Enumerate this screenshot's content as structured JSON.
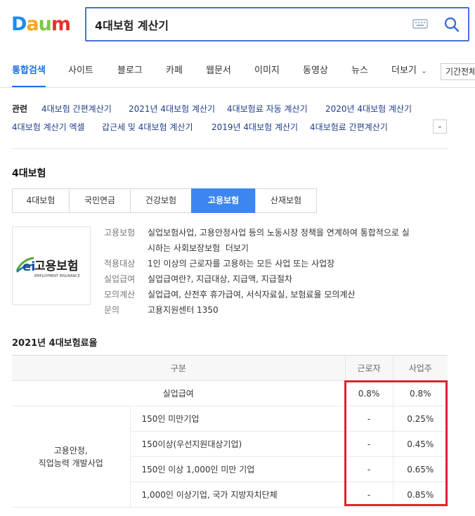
{
  "brand": {
    "logo_letters": [
      "D",
      "a",
      "u",
      "m"
    ],
    "colors": [
      "#1d8bf1",
      "#f5a623",
      "#7ac943",
      "#e5322d"
    ]
  },
  "search": {
    "query": "4대보험 계산기"
  },
  "nav": {
    "tabs": [
      "통합검색",
      "사이트",
      "블로그",
      "카페",
      "웹문서",
      "이미지",
      "동영상",
      "뉴스",
      "더보기"
    ],
    "active": "통합검색",
    "period": "기간전체"
  },
  "related": {
    "label": "관련",
    "links": [
      "4대보험 간편계산기",
      "2021년 4대보험 계산기",
      "4대보험료 자동 계산기",
      "2020년 4대보험 계산기",
      "4대보험 계산기 엑셀",
      "갑근세 및 4대보험 계산기",
      "2019년 4대보험 계산기",
      "4대보험료 간편계산기"
    ]
  },
  "section_title": "4대보험",
  "subtabs": [
    "4대보험",
    "국민연금",
    "건강보험",
    "고용보험",
    "산재보험"
  ],
  "active_subtab": "고용보험",
  "logo_card": {
    "name": "고용보험",
    "sub": "EMPLOYMENT INSURANCE"
  },
  "info": {
    "row1_key": "고용보험",
    "row1_val_a": "실업보험사업, 고용안정사업 등의 노동시장 정책을 연계하여 통합적으로 실",
    "row1_val_b": "시하는 사회보장보험",
    "row1_more": "더보기",
    "row2_key": "적용대상",
    "row2_val": "1인 이상의 근로자를 고용하는 모든 사업 또는 사업장",
    "row3_key": "실업급여",
    "row3_val": "실업급여란?, 지급대상, 지급액, 지급절차",
    "row4_key": "모의계산",
    "row4_val": "실업급여, 산전후 휴가급여, 서식자료실, 보험료율 모의계산",
    "row5_key": "문의",
    "row5_val": "고용지원센터 1350"
  },
  "rates": {
    "title": "2021년 4대보험료율",
    "headers": {
      "category": "구분",
      "worker": "근로자",
      "employer": "사업주"
    },
    "unemployment": {
      "label": "실업급여",
      "worker": "0.8%",
      "employer": "0.8%"
    },
    "group_label_a": "고용안정,",
    "group_label_b": "직업능력 개발사업",
    "rows": [
      {
        "label": "150인 미만기업",
        "worker": "-",
        "employer": "0.25%"
      },
      {
        "label": "150이상(우선지원대상기업)",
        "worker": "-",
        "employer": "0.45%"
      },
      {
        "label": "150인 이상 1,000인 미만 기업",
        "worker": "-",
        "employer": "0.65%"
      },
      {
        "label": "1,000인 이상기업, 국가 지방자치단체",
        "worker": "-",
        "employer": "0.85%"
      }
    ]
  }
}
